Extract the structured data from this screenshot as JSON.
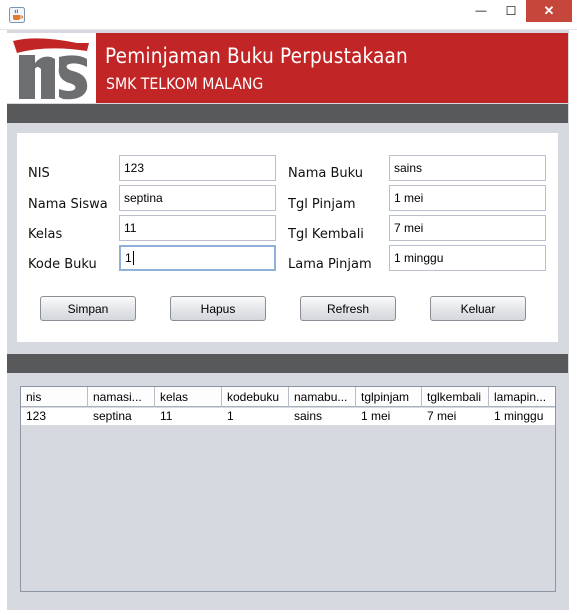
{
  "window": {
    "minimize_glyph": "—",
    "maximize_glyph": "☐",
    "close_glyph": "✕"
  },
  "header": {
    "title": "Peminjaman Buku Perpustakaan",
    "subtitle": "SMK TELKOM MALANG"
  },
  "form": {
    "nis_label": "NIS",
    "nis_value": "123",
    "nama_siswa_label": "Nama Siswa",
    "nama_siswa_value": "septina",
    "kelas_label": "Kelas",
    "kelas_value": "11",
    "kode_buku_label": "Kode Buku",
    "kode_buku_value": "1",
    "nama_buku_label": "Nama Buku",
    "nama_buku_value": "sains",
    "tgl_pinjam_label": "Tgl Pinjam",
    "tgl_pinjam_value": "1 mei",
    "tgl_kembali_label": "Tgl Kembali",
    "tgl_kembali_value": "7 mei",
    "lama_pinjam_label": "Lama Pinjam",
    "lama_pinjam_value": "1 minggu"
  },
  "buttons": {
    "simpan": "Simpan",
    "hapus": "Hapus",
    "refresh": "Refresh",
    "keluar": "Keluar"
  },
  "table": {
    "columns": [
      "nis",
      "namasi...",
      "kelas",
      "kodebuku",
      "namabu...",
      "tglpinjam",
      "tglkembali",
      "lamapin..."
    ],
    "rows": [
      [
        "123",
        "septina",
        "11",
        "1",
        "sains",
        "1 mei",
        "7 mei",
        "1 minggu"
      ]
    ]
  },
  "colors": {
    "banner_red": "#c22526",
    "strip_gray": "#58595b",
    "frame_bg": "#d6d9df",
    "close_red": "#c7463b"
  },
  "icons": {
    "app": "java-cup-icon",
    "logo": "telkom-school-logo"
  }
}
